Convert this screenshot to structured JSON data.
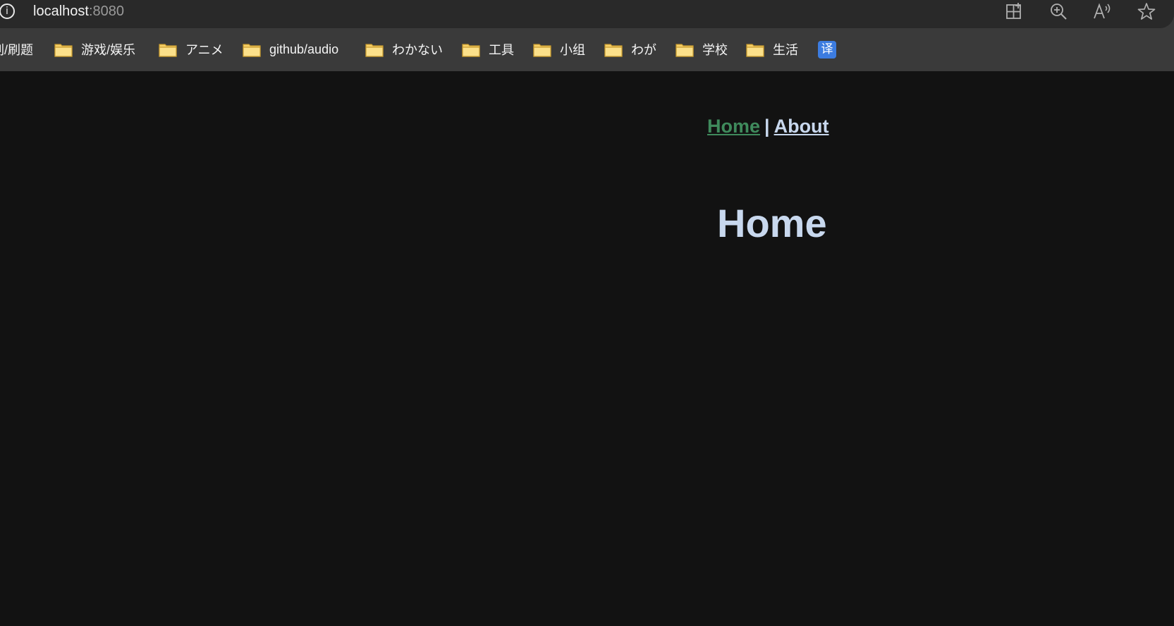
{
  "browser": {
    "url_host": "localhost",
    "url_port": ":8080",
    "info_glyph": "i",
    "toolbar_icons": [
      "split-screen-icon",
      "zoom-icon",
      "read-aloud-icon",
      "favorite-star-icon"
    ],
    "bookmarks": [
      {
        "label": "刷/刷题",
        "icon": "folder-icon"
      },
      {
        "label": "游戏/娱乐",
        "icon": "folder-icon"
      },
      {
        "label": "アニメ",
        "icon": "folder-icon"
      },
      {
        "label": "github/audio",
        "icon": "folder-icon"
      },
      {
        "label": "わかない",
        "icon": "folder-icon"
      },
      {
        "label": "工具",
        "icon": "folder-icon"
      },
      {
        "label": "小组",
        "icon": "folder-icon"
      },
      {
        "label": "わが",
        "icon": "folder-icon"
      },
      {
        "label": "学校",
        "icon": "folder-icon"
      },
      {
        "label": "生活",
        "icon": "folder-icon"
      }
    ],
    "translate_glyph": "译"
  },
  "page": {
    "nav": {
      "home": "Home",
      "separator": "|",
      "about": "About"
    },
    "title": "Home"
  },
  "colors": {
    "background": "#121212",
    "chrome": "#3a3a3a",
    "address_bar": "#292929",
    "active_link": "#3f8a5c",
    "text": "#c8d8ee",
    "folder": "#f6d068"
  }
}
